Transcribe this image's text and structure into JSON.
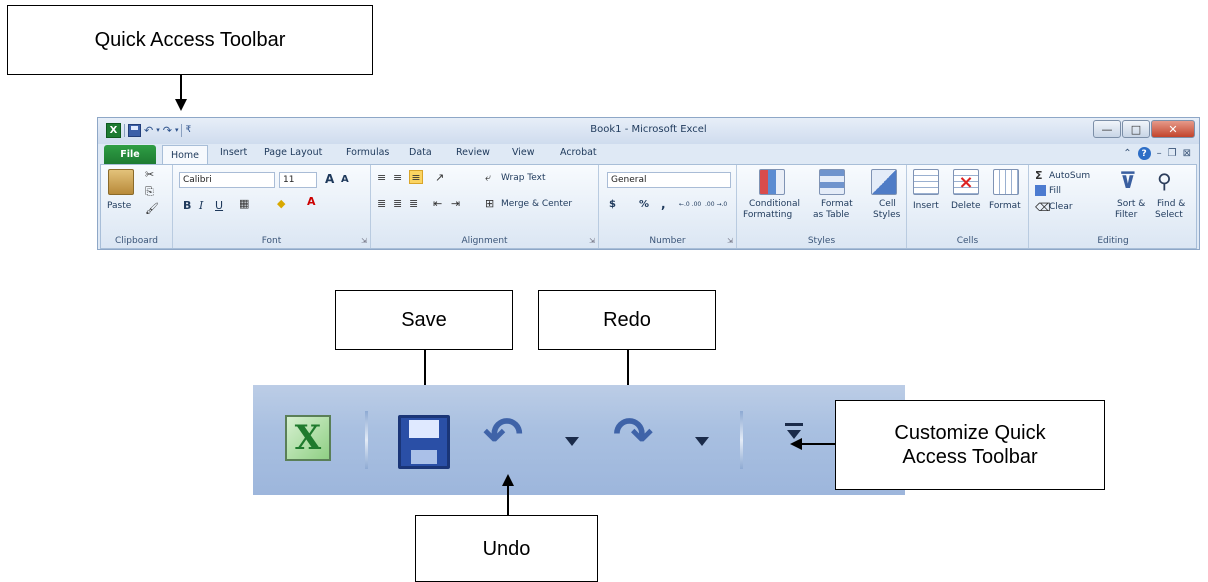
{
  "callouts": {
    "quick_access_toolbar": "Quick Access Toolbar",
    "save": "Save",
    "redo": "Redo",
    "undo": "Undo",
    "customize_line1": "Customize Quick",
    "customize_line2": "Access Toolbar"
  },
  "excel": {
    "title": "Book1 - Microsoft Excel",
    "app_icon": "excel-icon",
    "tabs": [
      "File",
      "Home",
      "Insert",
      "Page Layout",
      "Formulas",
      "Data",
      "Review",
      "View",
      "Acrobat"
    ],
    "active_tab": "Home",
    "accent_file_tab": "#1e7b32",
    "clipboard": {
      "paste": "Paste",
      "label": "Clipboard"
    },
    "font": {
      "name": "Calibri",
      "size": "11",
      "grow": "A",
      "shrink": "A",
      "bold": "B",
      "italic": "I",
      "underline": "U",
      "label": "Font"
    },
    "alignment": {
      "wrap": "Wrap Text",
      "merge": "Merge & Center",
      "label": "Alignment"
    },
    "number": {
      "format": "General",
      "currency": "$",
      "percent": "%",
      "comma": ",",
      "inc_decimal": "←.0 .00",
      "dec_decimal": ".00 →.0",
      "label": "Number"
    },
    "styles": {
      "conditional_line1": "Conditional",
      "conditional_line2": "Formatting",
      "format_table_line1": "Format",
      "format_table_line2": "as Table",
      "cell_styles_line1": "Cell",
      "cell_styles_line2": "Styles",
      "label": "Styles"
    },
    "cells": {
      "insert": "Insert",
      "delete": "Delete",
      "format": "Format",
      "label": "Cells"
    },
    "editing": {
      "autosum": "AutoSum",
      "fill": "Fill",
      "clear": "Clear",
      "sort_line1": "Sort &",
      "sort_line2": "Filter",
      "find_line1": "Find &",
      "find_line2": "Select",
      "label": "Editing"
    }
  },
  "zoomed_qat": {
    "icons": [
      "excel-icon",
      "save-icon",
      "undo-icon",
      "undo-dropdown-icon",
      "redo-icon",
      "redo-dropdown-icon",
      "customize-qat-icon"
    ]
  }
}
